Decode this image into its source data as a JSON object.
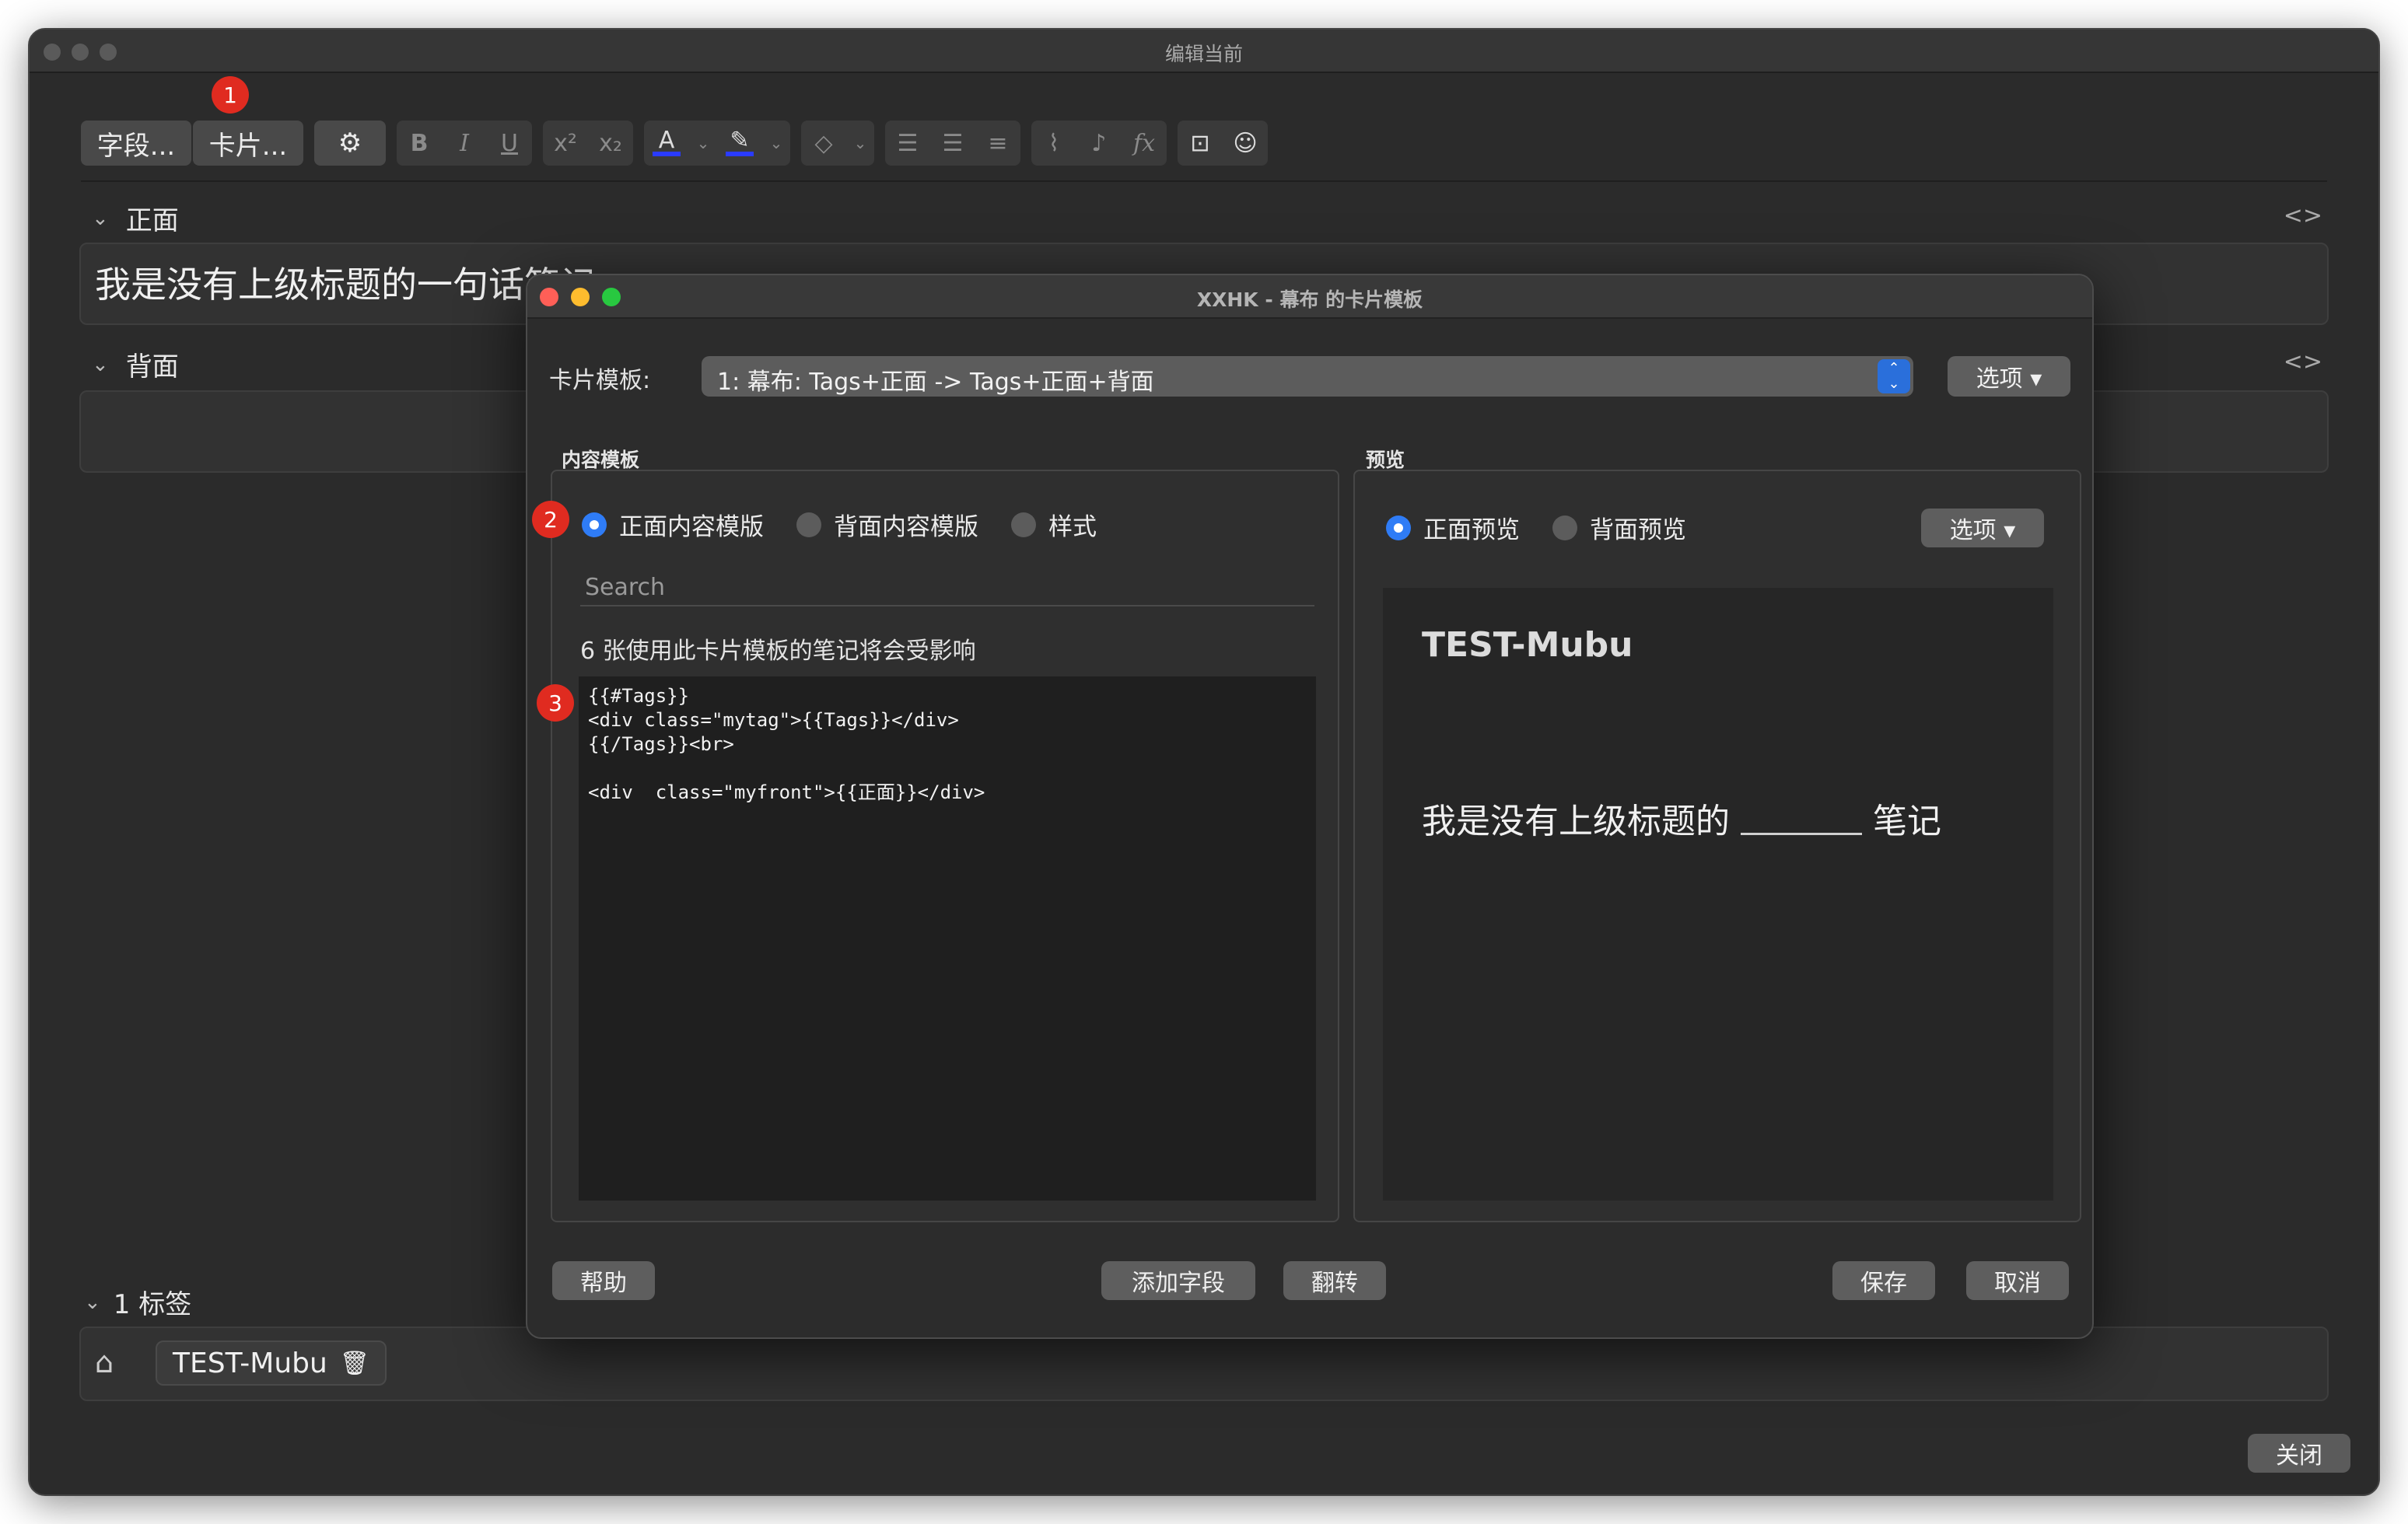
{
  "window": {
    "title": "编辑当前"
  },
  "toolbar": {
    "fields_label": "字段...",
    "cards_label": "卡片...",
    "badge1": "1",
    "icons": [
      "gear-icon",
      "bold-icon",
      "italic-icon",
      "underline-icon",
      "superscript-icon",
      "subscript-icon",
      "text-color-icon",
      "highlight-icon",
      "eraser-icon",
      "bullet-list-icon",
      "numbered-list-icon",
      "align-icon",
      "attach-icon",
      "mic-icon",
      "formula-icon",
      "html-editor-icon",
      "image-occlusion-icon"
    ],
    "bold": "B",
    "italic": "I",
    "underline": "U"
  },
  "editor": {
    "front_label": "正面",
    "front_value": "我是没有上级标题的一句话笔记",
    "back_label": "背面",
    "back_value": "",
    "code_toggle": "<>",
    "tags_label": "1 标签",
    "tag": "TEST-Mubu",
    "close": "关闭"
  },
  "dialog": {
    "title": "XXHK - 幕布 的卡片模板",
    "template_label": "卡片模板:",
    "template_value": "1: 幕布: Tags+正面 -> Tags+正面+背面",
    "options": "选项 ▾",
    "content_section": "内容模板",
    "preview_section": "预览",
    "badge2": "2",
    "badge3": "3",
    "radio_front": "正面内容模版",
    "radio_back": "背面内容模版",
    "radio_style": "样式",
    "search_placeholder": "Search",
    "affected": "6 张使用此卡片模板的笔记将会受影响",
    "code": "{{#Tags}}\n<div class=\"mytag\">{{Tags}}</div>\n{{/Tags}}<br>\n\n<div  class=\"myfront\">{{正面}}</div>",
    "preview_front": "正面预览",
    "preview_back": "背面预览",
    "preview_options": "选项 ▾",
    "preview_tag": "TEST-Mubu",
    "preview_text_before": "我是没有上级标题的",
    "preview_text_after": "笔记",
    "help": "帮助",
    "add_field": "添加字段",
    "flip": "翻转",
    "save": "保存",
    "cancel": "取消"
  },
  "colors": {
    "accent": "#2f7cf6",
    "badge": "#e02b20",
    "close_red": "#ff5f57",
    "min_yellow": "#febc2e",
    "max_green": "#28c840"
  }
}
